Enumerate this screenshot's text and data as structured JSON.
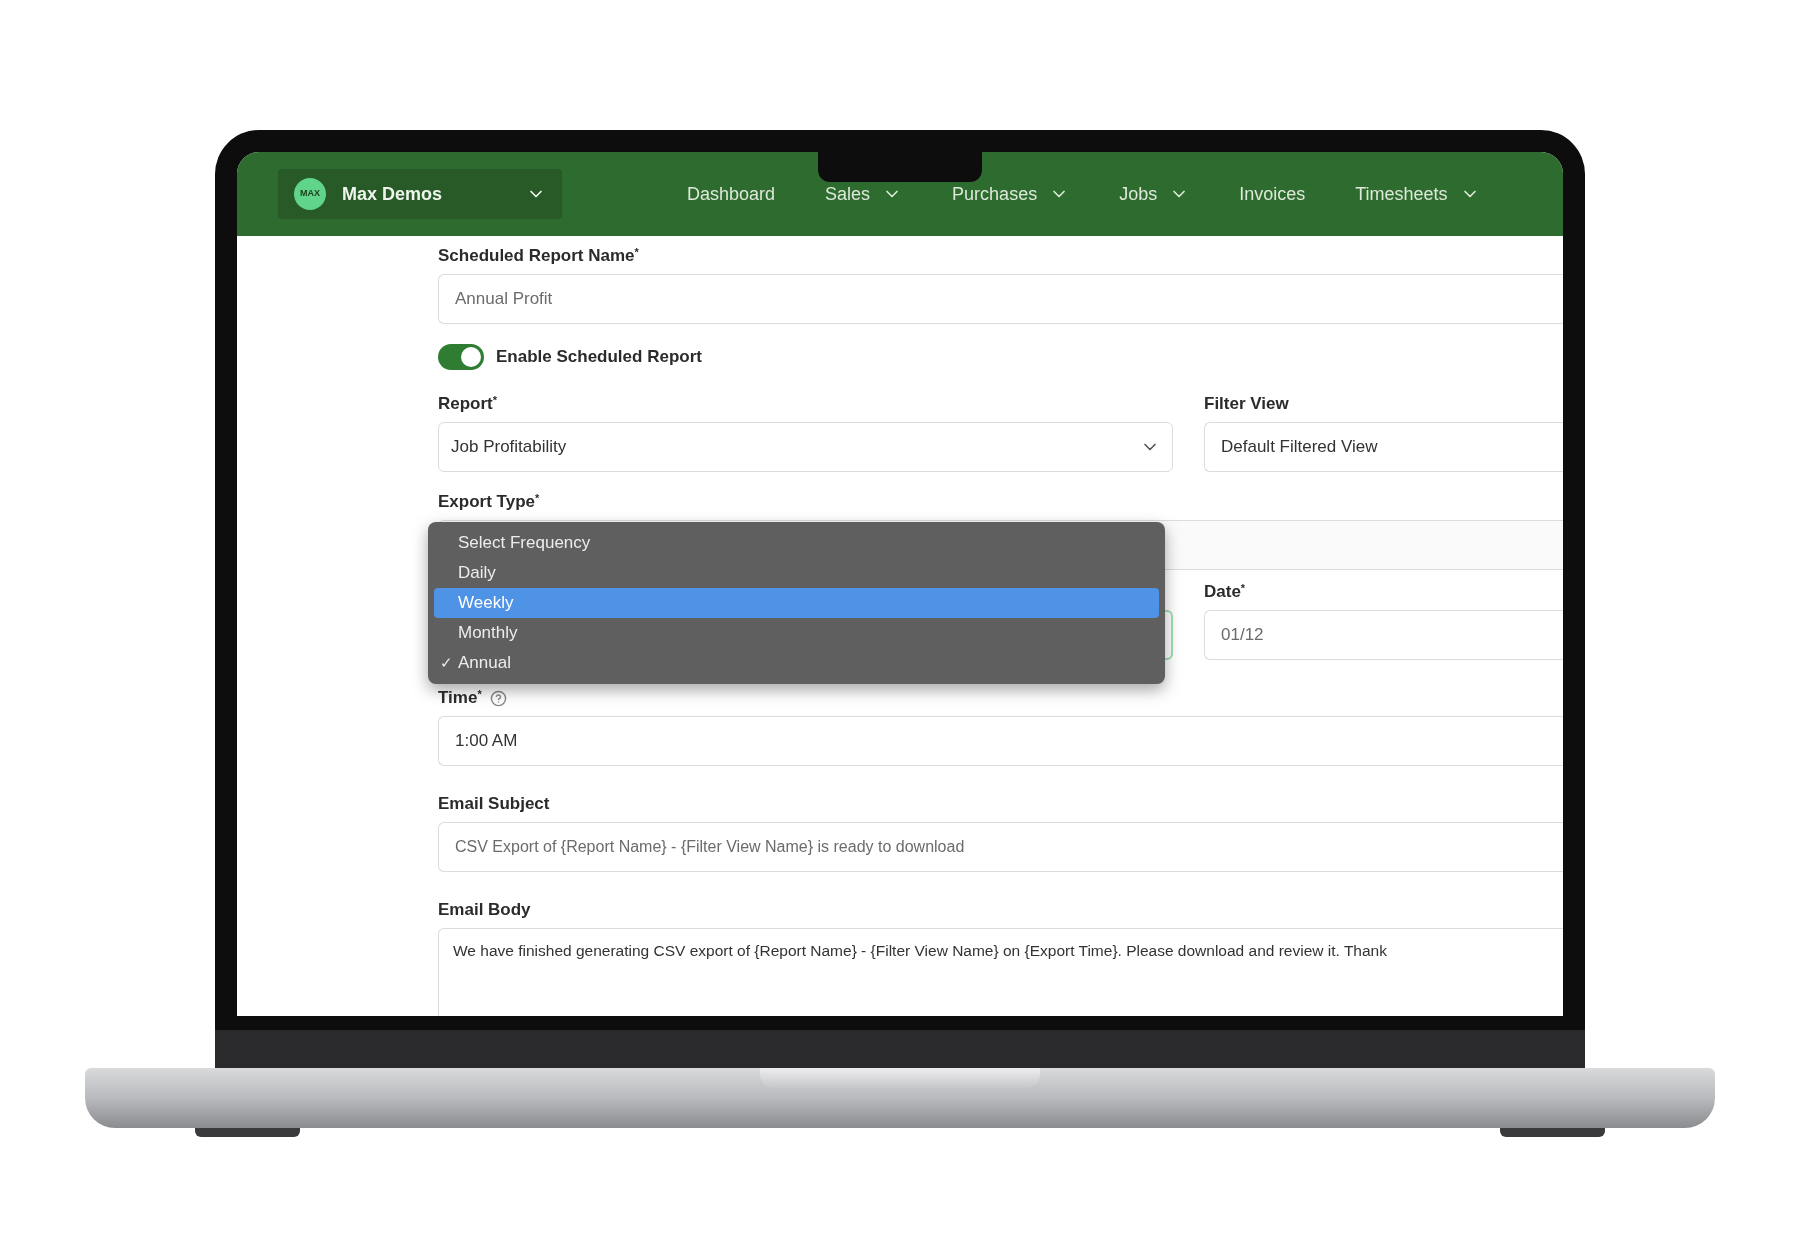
{
  "app": {
    "logo_text": "MAX",
    "org_name": "Max Demos"
  },
  "nav": [
    {
      "label": "Dashboard",
      "has_menu": false
    },
    {
      "label": "Sales",
      "has_menu": true
    },
    {
      "label": "Purchases",
      "has_menu": true
    },
    {
      "label": "Jobs",
      "has_menu": true
    },
    {
      "label": "Invoices",
      "has_menu": false
    },
    {
      "label": "Timesheets",
      "has_menu": true
    }
  ],
  "form": {
    "name": {
      "label": "Scheduled Report Name$^{*}$",
      "value": "Annual Profit"
    },
    "enable": {
      "label": "Enable Scheduled Report",
      "on": true
    },
    "report": {
      "label": "Report$^{*}$",
      "value": "Job Profitability"
    },
    "filter_view": {
      "label": "Filter View",
      "value": "Default Filtered View"
    },
    "export_type": {
      "label": "Export Type$^{*}$"
    },
    "date": {
      "label": "Date$^{*}$",
      "value": "01/12"
    },
    "time": {
      "label": "Time$^{*}$",
      "value": "1:00 AM"
    },
    "email_subject": {
      "label": "Email Subject",
      "value": "CSV Export of {Report Name} - {Filter View Name} is ready to download"
    },
    "email_body": {
      "label": "Email Body",
      "value": "We have finished generating CSV export of {Report Name} - {Filter View Name} on {Export Time}. Please download and review it. Thank"
    }
  },
  "frequency_menu": {
    "check_mark": "✓",
    "items": [
      {
        "label": "Select Frequency",
        "selected": false,
        "checked": false
      },
      {
        "label": "Daily",
        "selected": false,
        "checked": false
      },
      {
        "label": "Weekly",
        "selected": true,
        "checked": false
      },
      {
        "label": "Monthly",
        "selected": false,
        "checked": false
      },
      {
        "label": "Annual",
        "selected": false,
        "checked": true
      }
    ]
  }
}
